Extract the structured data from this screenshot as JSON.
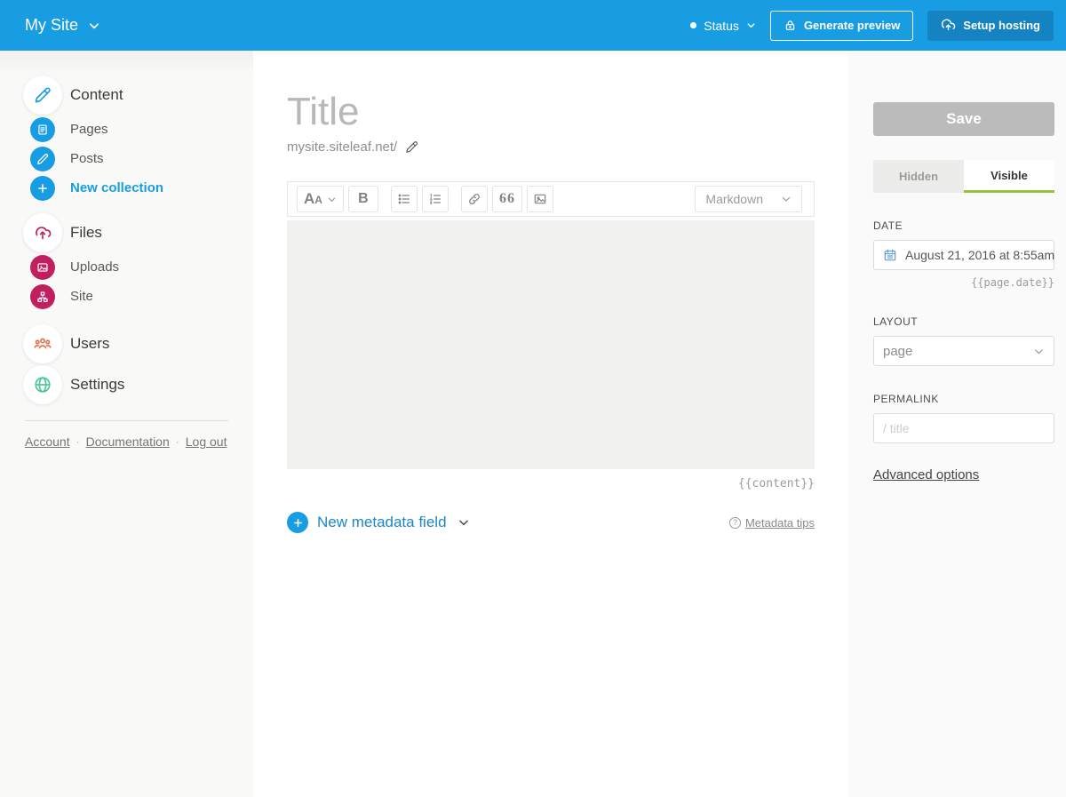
{
  "topbar": {
    "site_name": "My Site",
    "status_label": "Status",
    "generate_preview_label": "Generate preview",
    "setup_hosting_label": "Setup hosting",
    "bg_color": "#199de2",
    "setup_hosting_bg": "#1583c1"
  },
  "sidebar": {
    "sections": [
      {
        "label": "Content",
        "icon": "pencil-icon",
        "items": [
          {
            "label": "Pages",
            "icon": "page-icon"
          },
          {
            "label": "Posts",
            "icon": "pencil-icon"
          },
          {
            "label": "New collection",
            "icon": "plus-icon"
          }
        ]
      },
      {
        "label": "Files",
        "icon": "cloud-upload-icon",
        "items": [
          {
            "label": "Uploads",
            "icon": "image-icon"
          },
          {
            "label": "Site",
            "icon": "sitemap-icon"
          }
        ]
      },
      {
        "label": "Users",
        "icon": "users-icon",
        "items": []
      },
      {
        "label": "Settings",
        "icon": "globe-icon",
        "items": []
      }
    ],
    "footer_links": [
      "Account",
      "Documentation",
      "Log out"
    ],
    "link_separator": "·",
    "colors": {
      "blue": "#199de2",
      "crimson": "#c02060",
      "orange": "#e4704d",
      "green": "#4ec494"
    }
  },
  "editor": {
    "title_placeholder": "Title",
    "url_prefix": "mysite.siteleaf.net/",
    "toolbar": {
      "format_label": "Aa",
      "bold_label": "B",
      "quote_label": "66",
      "mode_selected": "Markdown"
    },
    "content_token": "{{content}}",
    "new_metadata_label": "New metadata field",
    "metadata_tips_label": "Metadata tips"
  },
  "panel": {
    "save_label": "Save",
    "visibility_tabs": [
      {
        "label": "Hidden",
        "active": false
      },
      {
        "label": "Visible",
        "active": true
      }
    ],
    "active_tab_underline": "#94c13d",
    "date": {
      "label": "DATE",
      "value": "August 21, 2016 at 8:55am",
      "token": "{{page.date}}"
    },
    "layout": {
      "label": "LAYOUT",
      "value": "page"
    },
    "permalink": {
      "label": "PERMALINK",
      "placeholder": "/ title"
    },
    "advanced_label": "Advanced options"
  },
  "icons": {
    "chevron-down-icon": "⌄",
    "plus-icon": "+",
    "status-dot": "●",
    "question-icon": "?"
  }
}
